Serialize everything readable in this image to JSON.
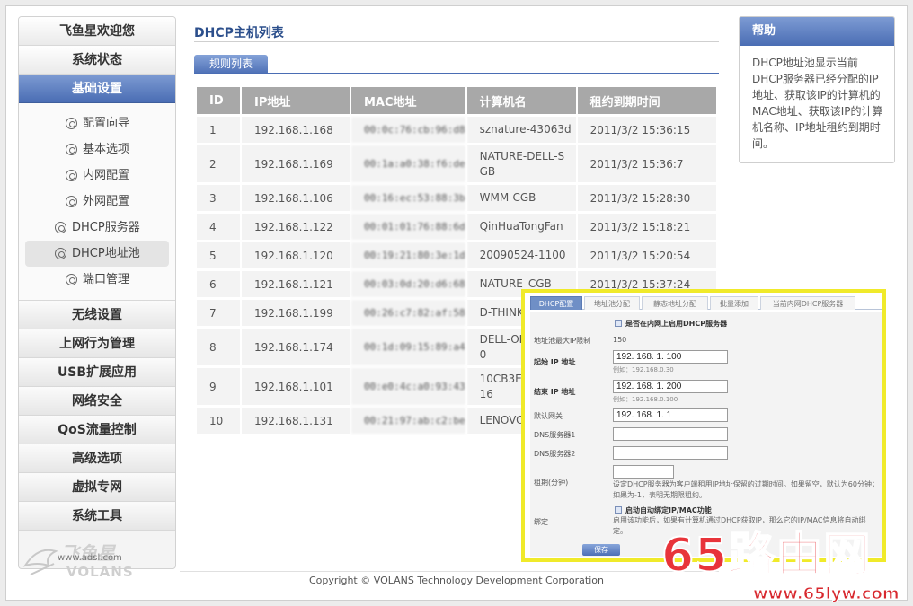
{
  "sidebar": {
    "welcome": "飞鱼星欢迎您",
    "status": "系统状态",
    "basic": "基础设置",
    "sub_items": [
      "配置向导",
      "基本选项",
      "内网配置",
      "外网配置",
      "DHCP服务器",
      "DHCP地址池",
      "端口管理"
    ],
    "menu": [
      "无线设置",
      "上网行为管理",
      "USB扩展应用",
      "网络安全",
      "QoS流量控制",
      "高级选项",
      "虚拟专网",
      "系统工具"
    ],
    "logo_text": "飞鱼星",
    "logo_sub": "VOLANS",
    "logo_url": "www.adsl.com"
  },
  "main": {
    "title": "DHCP主机列表",
    "tab": "规则列表",
    "columns": [
      "ID",
      "IP地址",
      "MAC地址",
      "计算机名",
      "租约到期时间"
    ],
    "rows": [
      [
        "1",
        "192.168.1.168",
        "00:0c:76:cb:96:d8",
        "sznature-43063d",
        "2011/3/2 15:36:15"
      ],
      [
        "2",
        "192.168.1.169",
        "00:1a:a0:38:f6:de",
        "NATURE-DELL-S\nGB",
        "2011/3/2 15:36:7"
      ],
      [
        "3",
        "192.168.1.106",
        "00:16:ec:53:88:3b",
        "WMM-CGB",
        "2011/3/2 15:28:30"
      ],
      [
        "4",
        "192.168.1.122",
        "00:01:01:76:88:6d",
        "QinHuaTongFan",
        "2011/3/2 15:18:21"
      ],
      [
        "5",
        "192.168.1.120",
        "00:19:21:80:3e:1d",
        "20090524-1100",
        "2011/3/2 15:20:54"
      ],
      [
        "6",
        "192.168.1.121",
        "00:03:0d:20:d6:68",
        "NATURE_CGB",
        "2011/3/2 15:37:24"
      ],
      [
        "7",
        "192.168.1.199",
        "00:26:c7:82:af:58",
        "D-THINK",
        ""
      ],
      [
        "8",
        "192.168.1.174",
        "00:1d:09:15:89:a4",
        "DELL-OP\n0",
        ""
      ],
      [
        "9",
        "192.168.1.101",
        "00:e0:4c:a0:93:43",
        "10CB3EE\n16",
        ""
      ],
      [
        "10",
        "192.168.1.131",
        "00:21:97:ab:c2:be",
        "LENOVO",
        ""
      ]
    ]
  },
  "help": {
    "title": "帮助",
    "text": "DHCP地址池显示当前DHCP服务器已经分配的IP地址、获取该IP的计算机的MAC地址、获取该IP的计算机名称、IP地址租约到期时间。"
  },
  "footer": "Copyright © VOLANS Technology Development Corporation",
  "overlay": {
    "tabs": [
      "DHCP配置",
      "地址池分配",
      "静态地址分配",
      "批量添加",
      "当前内网DHCP服务器"
    ],
    "enable_label": "是否在内网上启用DHCP服务器",
    "pool_max_label": "地址池最大IP限制",
    "pool_max_value": "150",
    "start_label": "起始  IP 地址",
    "start_value": "192. 168. 1. 100",
    "start_hint": "例如：192.168.0.30",
    "end_label": "结束  IP 地址",
    "end_value": "192. 168. 1. 200",
    "end_hint": "例如：192.168.0.100",
    "gateway_label": "默认网关",
    "gateway_value": "192. 168. 1. 1",
    "dns1_label": "DNS服务器1",
    "dns2_label": "DNS服务器2",
    "lease_label": "租期(分钟)",
    "lease_desc": "设定DHCP服务器为客户端租用IP地址保留的过期时间。如果留空，默认为60分钟；如果为-1，表明无期限租约。",
    "bind_label": "绑定",
    "bind_title": "启动自动绑定IP/MAC功能",
    "bind_desc": "启用该功能后，如果有计算机通过DHCP获取IP，那么它的IP/MAC信息将自动绑定。",
    "save": "保存"
  },
  "watermark": {
    "big": "65路由网",
    "small": "www.65lyw.com"
  }
}
